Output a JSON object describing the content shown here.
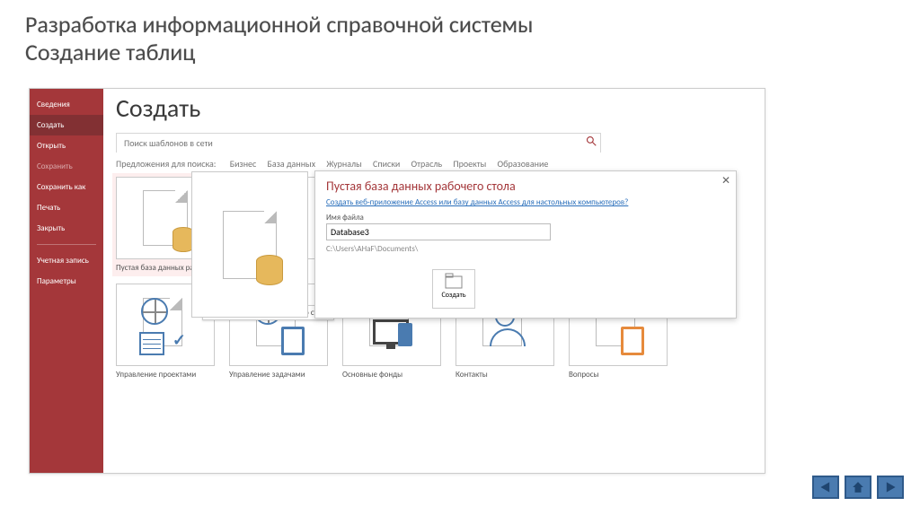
{
  "slide": {
    "title_line1": "Разработка информационной справочной системы",
    "title_line2": "Создание таблиц"
  },
  "sidebar": {
    "items": [
      {
        "label": "Сведения"
      },
      {
        "label": "Создать"
      },
      {
        "label": "Открыть"
      },
      {
        "label": "Сохранить"
      },
      {
        "label": "Сохранить как"
      },
      {
        "label": "Печать"
      },
      {
        "label": "Закрыть"
      },
      {
        "label": "Учетная запись"
      },
      {
        "label": "Параметры"
      }
    ]
  },
  "page_title": "Создать",
  "search": {
    "placeholder": "Поиск шаблонов в сети"
  },
  "suggestions": {
    "label": "Предложения для поиска:",
    "items": [
      "Бизнес",
      "База данных",
      "Журналы",
      "Списки",
      "Отрасль",
      "Проекты",
      "Образование"
    ]
  },
  "templates_row1": [
    {
      "label": "Пустая база данных раб"
    },
    {
      "label": ""
    }
  ],
  "templates_row2": [
    {
      "label": "Управление проектами"
    },
    {
      "label": "Управление задачами"
    },
    {
      "label": "Основные фонды"
    },
    {
      "label": "Контакты"
    },
    {
      "label": "Вопросы"
    }
  ],
  "tooltip": "Пустая база данных рабочего стола",
  "callout": {
    "title": "Пустая база данных рабочего стола",
    "link": "Создать веб-приложение Access или базу данных Access для настольных компьютеров?",
    "filename_label": "Имя файла",
    "filename_value": "Database3",
    "path": "C:\\Users\\AHaF\\Documents\\",
    "create_label": "Создать"
  }
}
